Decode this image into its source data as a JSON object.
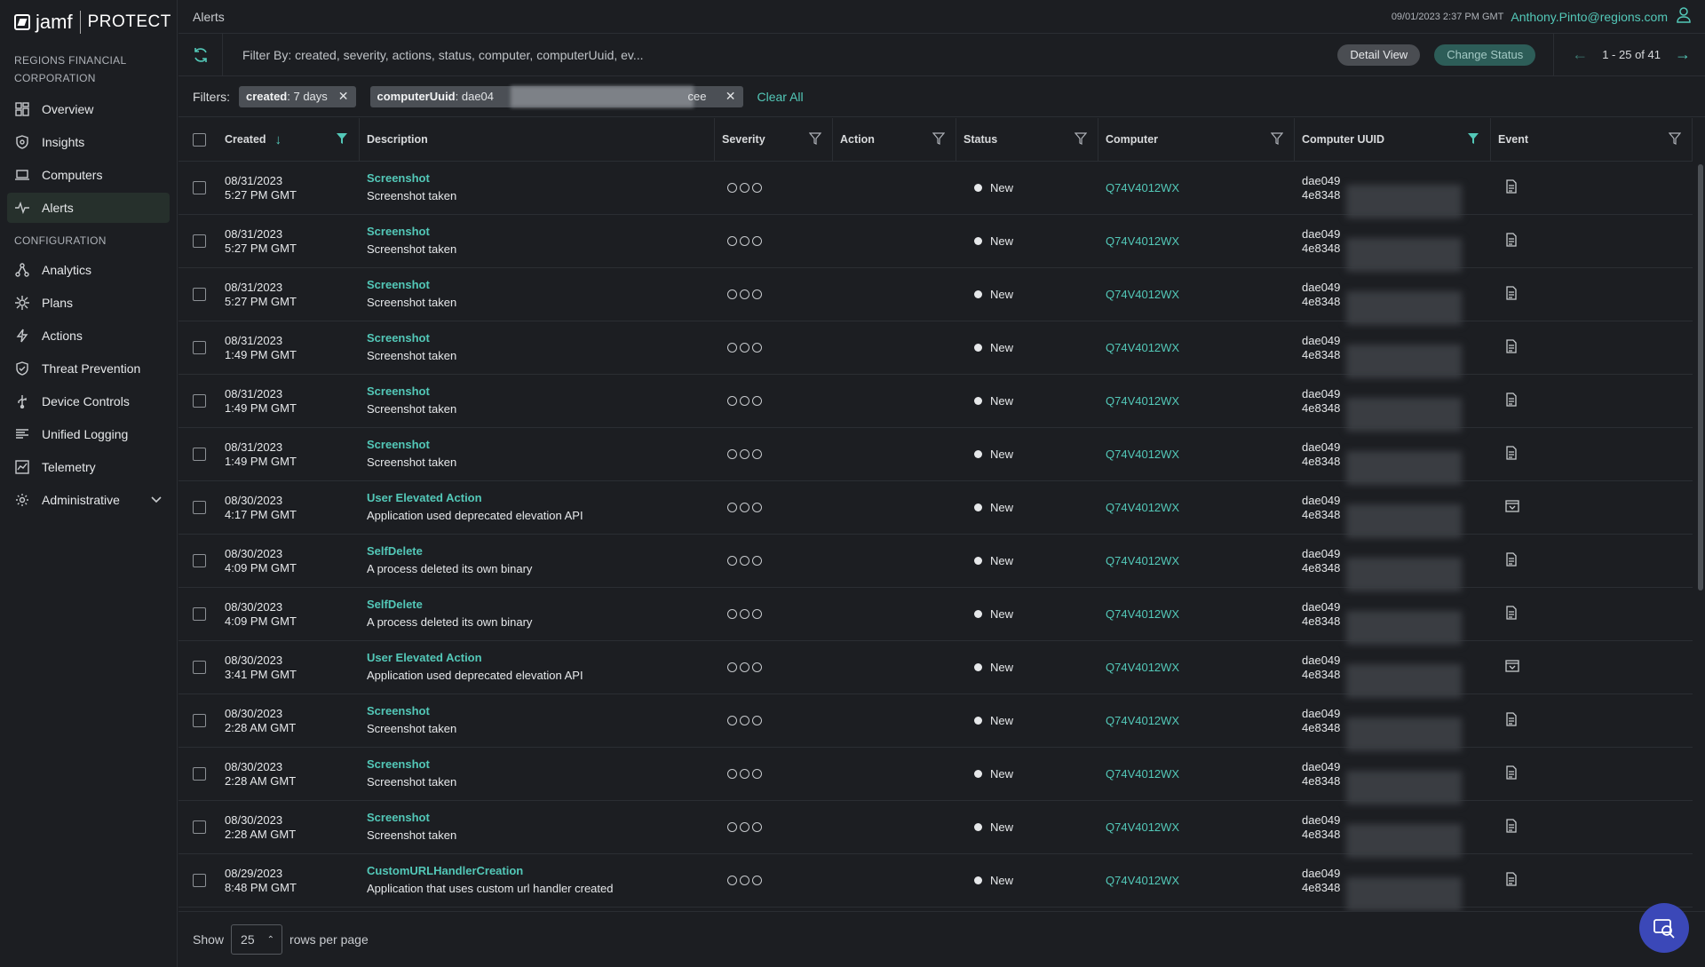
{
  "brand": {
    "name": "jamf",
    "product": "PROTECT"
  },
  "org": "REGIONS FINANCIAL CORPORATION",
  "nav": [
    {
      "label": "Overview",
      "icon": "overview-icon"
    },
    {
      "label": "Insights",
      "icon": "shield-icon"
    },
    {
      "label": "Computers",
      "icon": "laptop-icon"
    },
    {
      "label": "Alerts",
      "icon": "pulse-icon"
    }
  ],
  "config_label": "CONFIGURATION",
  "config_nav": [
    {
      "label": "Analytics",
      "icon": "analytics-icon"
    },
    {
      "label": "Plans",
      "icon": "gear-spokes-icon"
    },
    {
      "label": "Actions",
      "icon": "bolt-icon"
    },
    {
      "label": "Threat Prevention",
      "icon": "shield-check-icon"
    },
    {
      "label": "Device Controls",
      "icon": "usb-icon"
    },
    {
      "label": "Unified Logging",
      "icon": "log-icon"
    },
    {
      "label": "Telemetry",
      "icon": "telemetry-icon"
    },
    {
      "label": "Administrative",
      "icon": "gear-icon"
    }
  ],
  "header": {
    "title": "Alerts",
    "timestamp": "09/01/2023 2:37 PM GMT",
    "user": "Anthony.Pinto@regions.com"
  },
  "toolbar": {
    "filter_placeholder": "Filter By: created, severity, actions, status, computer, computerUuid, ev...",
    "detail_view": "Detail View",
    "change_status": "Change Status",
    "pager": "1 - 25 of 41"
  },
  "filters": {
    "label": "Filters:",
    "chip1_key": "created",
    "chip1_val": " : 7 days",
    "chip2_key": "computerUuid",
    "chip2_val": " : dae04",
    "chip2_tail": "cee",
    "clear_all": "Clear All"
  },
  "columns": {
    "created": "Created",
    "description": "Description",
    "severity": "Severity",
    "action": "Action",
    "status": "Status",
    "computer": "Computer",
    "computer_uuid": "Computer UUID",
    "event": "Event"
  },
  "rows": [
    {
      "date": "08/31/2023",
      "time": "5:27 PM GMT",
      "title": "Screenshot",
      "sub": "Screenshot taken",
      "status": "New",
      "computer": "Q74V4012WX",
      "uuid1": "dae049",
      "uuid2": "4e8348",
      "event": "doc"
    },
    {
      "date": "08/31/2023",
      "time": "5:27 PM GMT",
      "title": "Screenshot",
      "sub": "Screenshot taken",
      "status": "New",
      "computer": "Q74V4012WX",
      "uuid1": "dae049",
      "uuid2": "4e8348",
      "event": "doc"
    },
    {
      "date": "08/31/2023",
      "time": "5:27 PM GMT",
      "title": "Screenshot",
      "sub": "Screenshot taken",
      "status": "New",
      "computer": "Q74V4012WX",
      "uuid1": "dae049",
      "uuid2": "4e8348",
      "event": "doc"
    },
    {
      "date": "08/31/2023",
      "time": "1:49 PM GMT",
      "title": "Screenshot",
      "sub": "Screenshot taken",
      "status": "New",
      "computer": "Q74V4012WX",
      "uuid1": "dae049",
      "uuid2": "4e8348",
      "event": "doc"
    },
    {
      "date": "08/31/2023",
      "time": "1:49 PM GMT",
      "title": "Screenshot",
      "sub": "Screenshot taken",
      "status": "New",
      "computer": "Q74V4012WX",
      "uuid1": "dae049",
      "uuid2": "4e8348",
      "event": "doc"
    },
    {
      "date": "08/31/2023",
      "time": "1:49 PM GMT",
      "title": "Screenshot",
      "sub": "Screenshot taken",
      "status": "New",
      "computer": "Q74V4012WX",
      "uuid1": "dae049",
      "uuid2": "4e8348",
      "event": "doc"
    },
    {
      "date": "08/30/2023",
      "time": "4:17 PM GMT",
      "title": "User Elevated Action",
      "sub": "Application used deprecated elevation API",
      "status": "New",
      "computer": "Q74V4012WX",
      "uuid1": "dae049",
      "uuid2": "4e8348",
      "event": "app"
    },
    {
      "date": "08/30/2023",
      "time": "4:09 PM GMT",
      "title": "SelfDelete",
      "sub": "A process deleted its own binary",
      "status": "New",
      "computer": "Q74V4012WX",
      "uuid1": "dae049",
      "uuid2": "4e8348",
      "event": "doc"
    },
    {
      "date": "08/30/2023",
      "time": "4:09 PM GMT",
      "title": "SelfDelete",
      "sub": "A process deleted its own binary",
      "status": "New",
      "computer": "Q74V4012WX",
      "uuid1": "dae049",
      "uuid2": "4e8348",
      "event": "doc"
    },
    {
      "date": "08/30/2023",
      "time": "3:41 PM GMT",
      "title": "User Elevated Action",
      "sub": "Application used deprecated elevation API",
      "status": "New",
      "computer": "Q74V4012WX",
      "uuid1": "dae049",
      "uuid2": "4e8348",
      "event": "app"
    },
    {
      "date": "08/30/2023",
      "time": "2:28 AM GMT",
      "title": "Screenshot",
      "sub": "Screenshot taken",
      "status": "New",
      "computer": "Q74V4012WX",
      "uuid1": "dae049",
      "uuid2": "4e8348",
      "event": "doc"
    },
    {
      "date": "08/30/2023",
      "time": "2:28 AM GMT",
      "title": "Screenshot",
      "sub": "Screenshot taken",
      "status": "New",
      "computer": "Q74V4012WX",
      "uuid1": "dae049",
      "uuid2": "4e8348",
      "event": "doc"
    },
    {
      "date": "08/30/2023",
      "time": "2:28 AM GMT",
      "title": "Screenshot",
      "sub": "Screenshot taken",
      "status": "New",
      "computer": "Q74V4012WX",
      "uuid1": "dae049",
      "uuid2": "4e8348",
      "event": "doc"
    },
    {
      "date": "08/29/2023",
      "time": "8:48 PM GMT",
      "title": "CustomURLHandlerCreation",
      "sub": "Application that uses custom url handler created",
      "status": "New",
      "computer": "Q74V4012WX",
      "uuid1": "dae049",
      "uuid2": "4e8348",
      "event": "doc"
    }
  ],
  "footer": {
    "show": "Show",
    "rows_value": "25",
    "rows_suffix": "rows per page"
  },
  "colors": {
    "accent": "#53c8b8",
    "bg": "#1c1e22",
    "fab": "#3b48b8"
  }
}
